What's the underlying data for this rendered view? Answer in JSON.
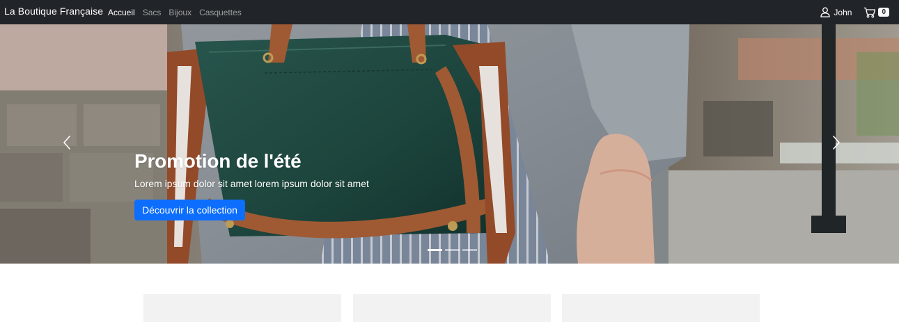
{
  "brand": "La Boutique Française",
  "nav": {
    "items": [
      {
        "label": "Accueil",
        "active": true
      },
      {
        "label": "Sacs",
        "active": false
      },
      {
        "label": "Bijoux",
        "active": false
      },
      {
        "label": "Casquettes",
        "active": false
      }
    ]
  },
  "account": {
    "name": "John",
    "icon": "person-icon"
  },
  "cart": {
    "count": "0",
    "icon": "cart-icon"
  },
  "hero": {
    "title": "Promotion de l'été",
    "text": "Lorem ipsum dolor sit amet lorem ipsum dolor sit amet",
    "button_label": "Découvrir la collection",
    "slides": 3,
    "active_slide": 1
  },
  "colors": {
    "navbar": "#212529",
    "primary": "#0d6efd",
    "bag_green": "#1f4a42",
    "leather": "#9b4f2c"
  }
}
